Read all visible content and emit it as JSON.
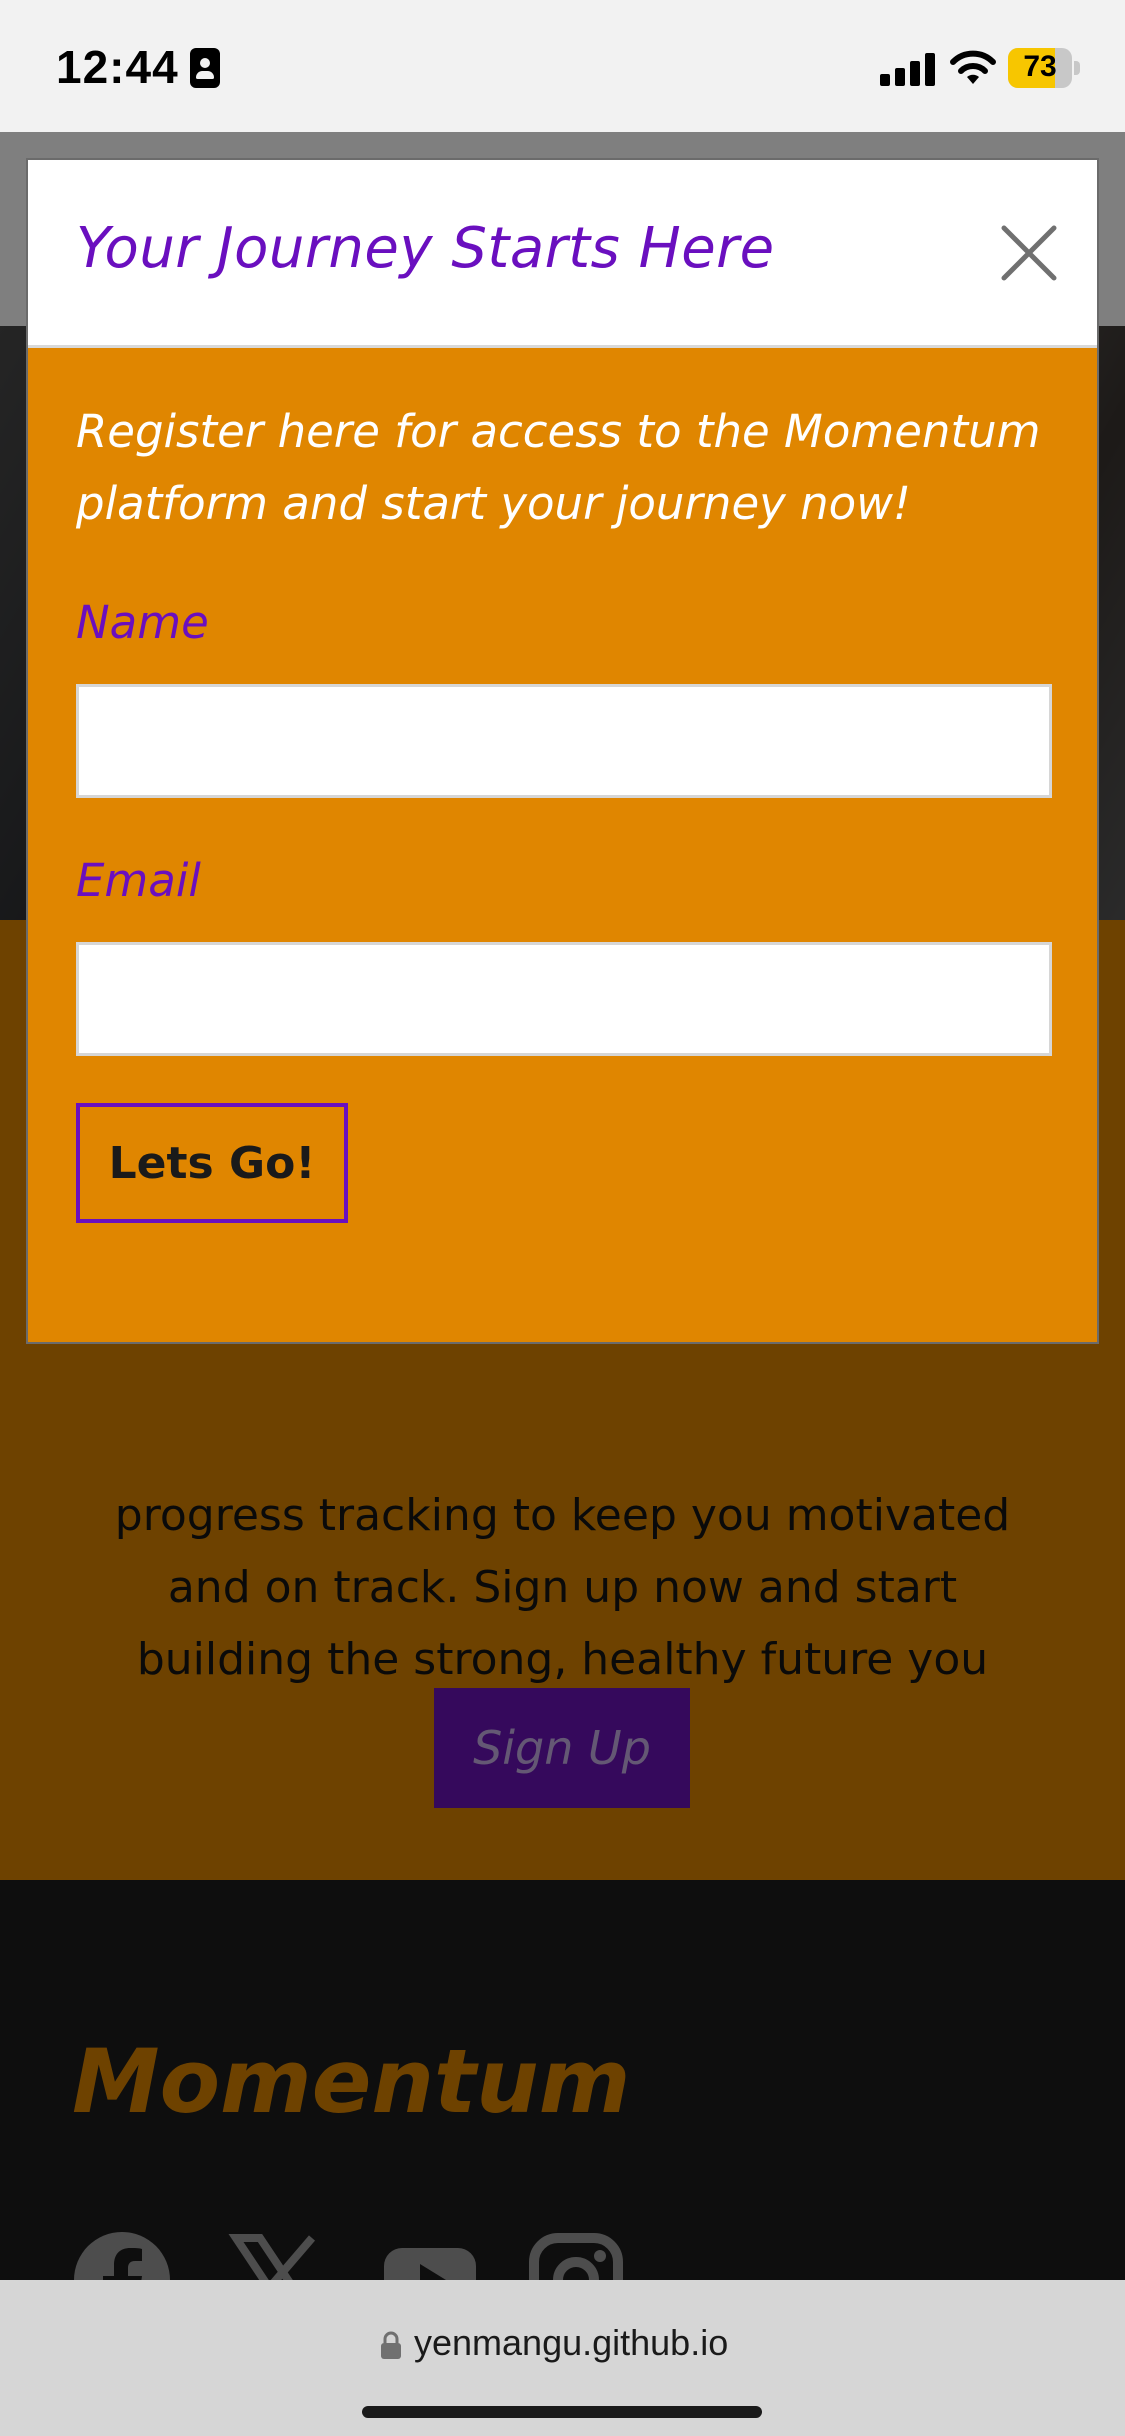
{
  "status_bar": {
    "time": "12:44",
    "battery": "73",
    "battery_level": 0.73
  },
  "page": {
    "about_text": "progress tracking to keep you motivated and on track. Sign up now and start building the strong, healthy future you deserve.\"",
    "signup_label": "Sign Up",
    "footer_brand": "Momentum",
    "social_icons": [
      "facebook-icon",
      "x-icon",
      "youtube-icon",
      "instagram-icon"
    ]
  },
  "modal": {
    "title": "Your Journey Starts Here",
    "intro": "Register here for access to the Momentum platform and start your journey now!",
    "name_label": "Name",
    "name_value": "",
    "email_label": "Email",
    "email_value": "",
    "submit_label": "Lets Go!"
  },
  "browser": {
    "url": "yenmangu.github.io"
  },
  "colors": {
    "accent_orange": "#e08600",
    "accent_purple": "#6a0fbf",
    "footer_dark": "#1c1c1c"
  }
}
